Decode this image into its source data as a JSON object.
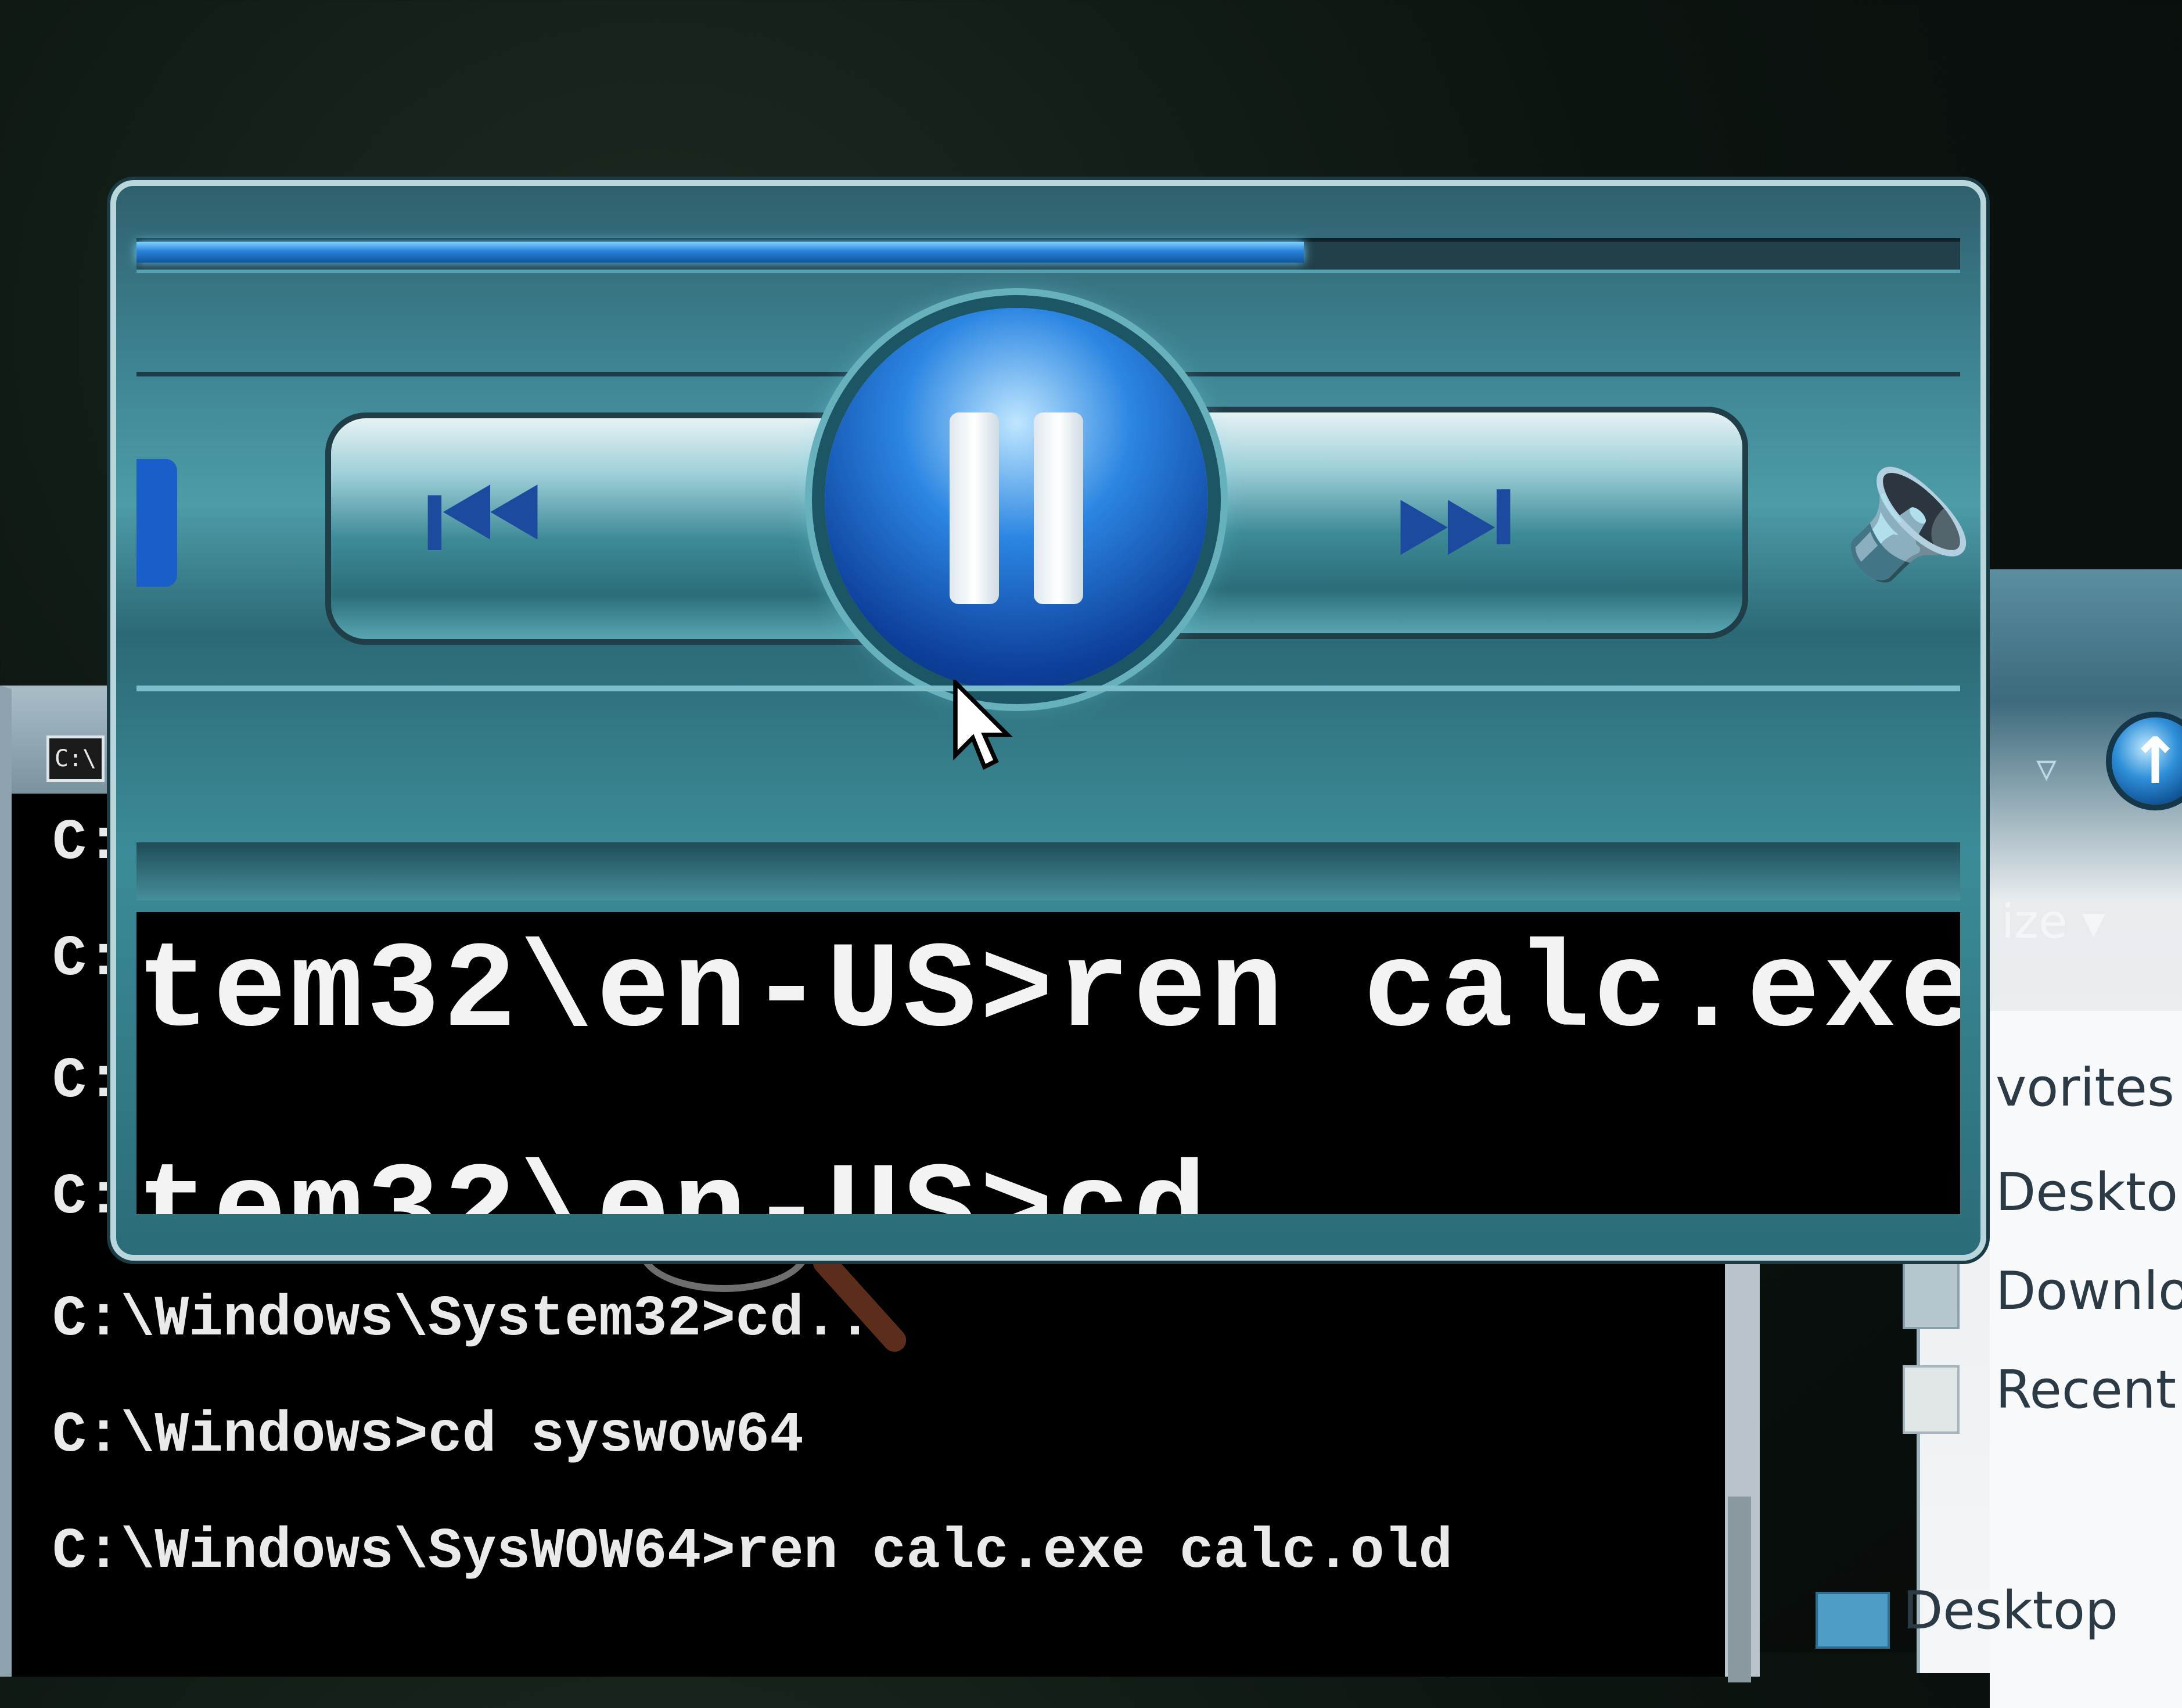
{
  "media_player": {
    "seek_progress": 0.64,
    "buttons": {
      "previous_icon": "skip-previous-icon",
      "play_pause_icon": "pause-icon",
      "next_icon": "skip-next-icon",
      "volume_icon": "speaker-icon"
    },
    "magnified_lines": [
      "tem32\\en-US>ren calc.exe",
      "tem32\\en-US>cd"
    ]
  },
  "console": {
    "title_icon_text": "C:\\",
    "prompt_fragments": [
      "C:",
      "C:",
      "C:",
      "C:"
    ],
    "lines": [
      "C:\\Windows\\System32>cd..",
      "C:\\Windows>cd syswow64",
      "C:\\Windows\\SysWOW64>ren calc.exe calc.old"
    ]
  },
  "explorer": {
    "organize_label": "ize",
    "nav_items": [
      "vorites",
      "Desktop",
      "Downlo",
      "Recent",
      "Desktop"
    ]
  },
  "colors": {
    "player_teal": "#3f8695",
    "seek_blue": "#2a83d9",
    "console_bg": "#000000",
    "console_text": "#eaeaea"
  }
}
